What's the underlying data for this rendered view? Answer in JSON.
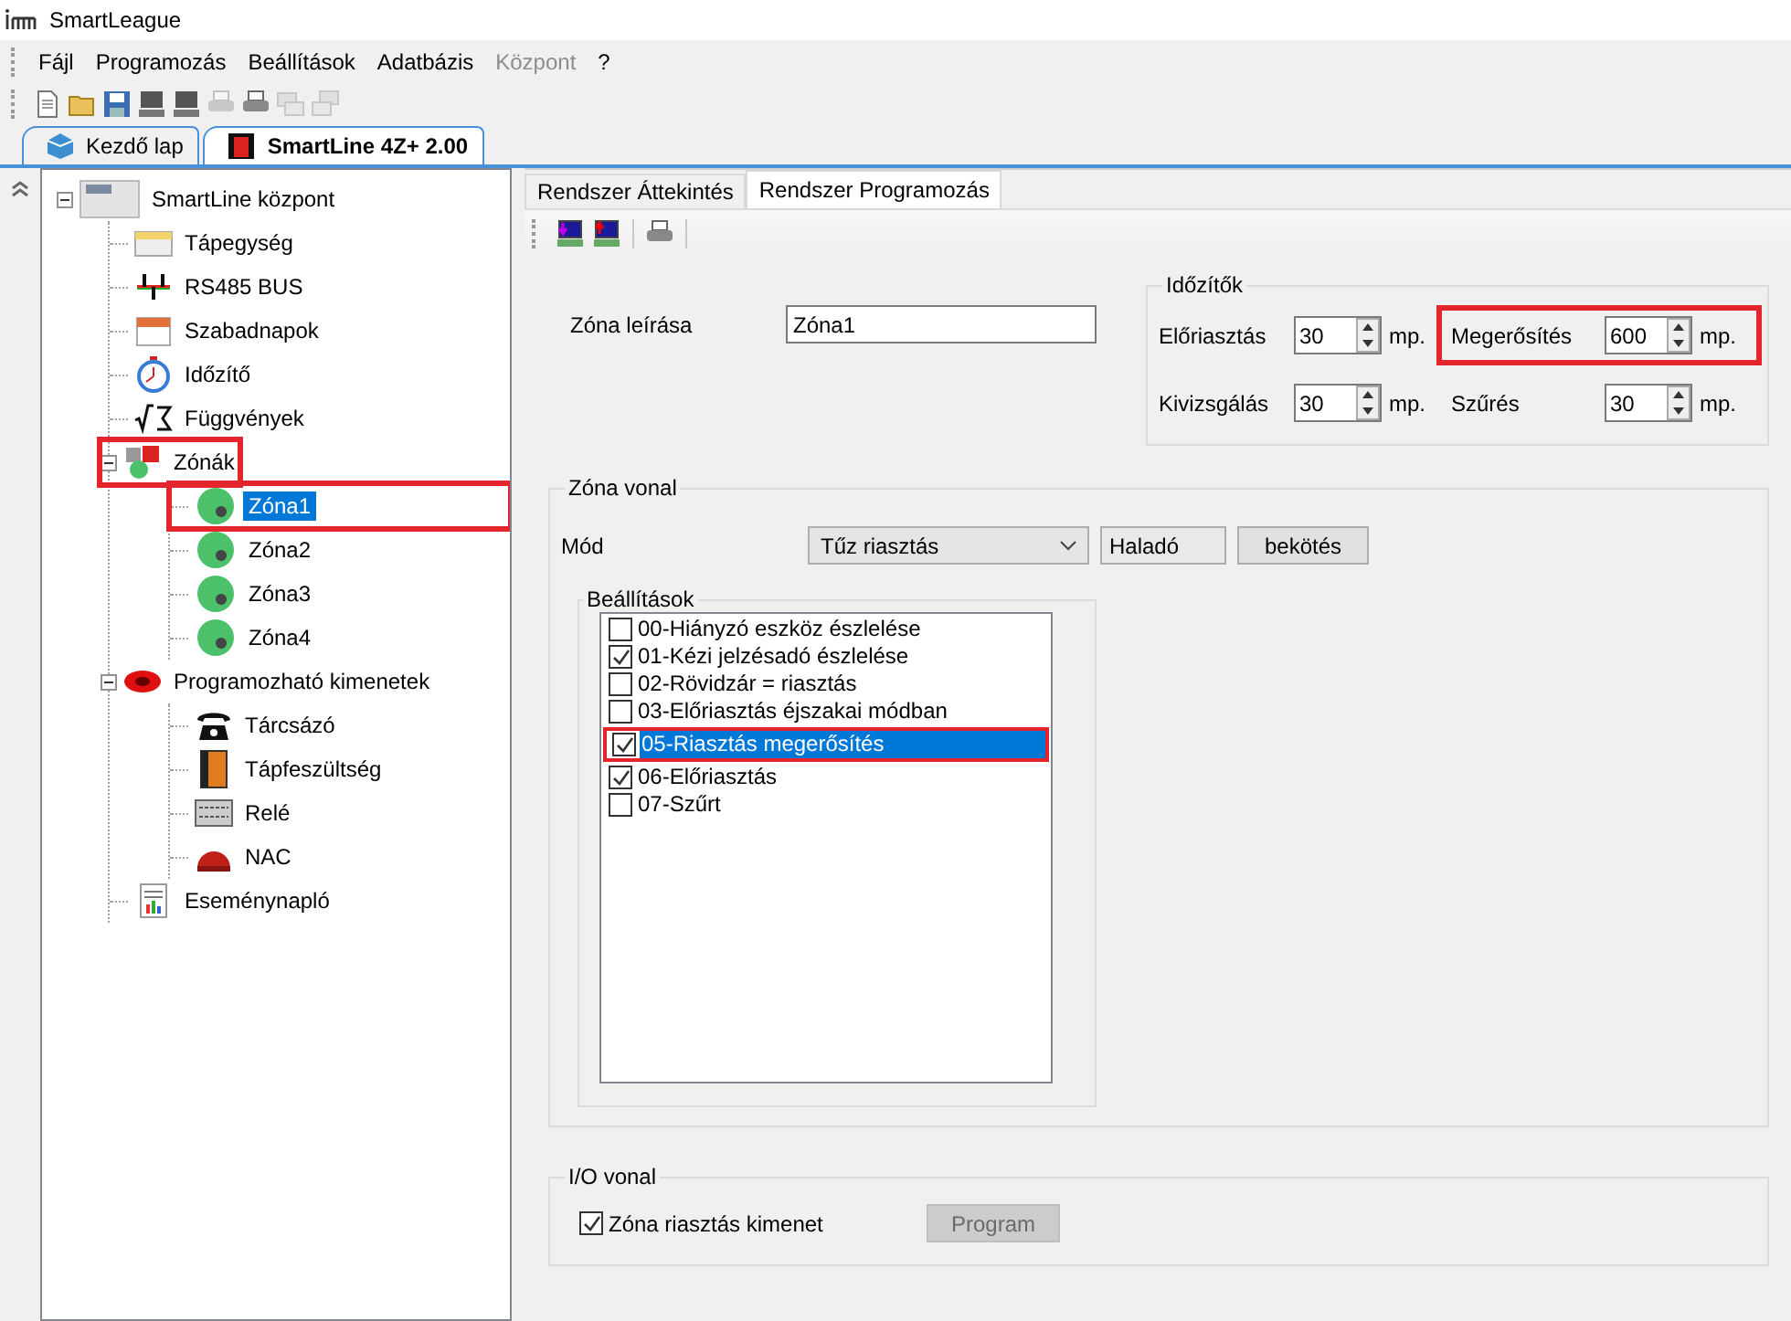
{
  "window": {
    "title": "SmartLeague"
  },
  "menu": [
    {
      "label": "Fájl",
      "disabled": false
    },
    {
      "label": "Programozás",
      "disabled": false
    },
    {
      "label": "Beállítások",
      "disabled": false
    },
    {
      "label": "Adatbázis",
      "disabled": false
    },
    {
      "label": "Központ",
      "disabled": true
    },
    {
      "label": "?",
      "disabled": false
    }
  ],
  "document_tabs": [
    {
      "label": "Kezdő lap",
      "selected": false
    },
    {
      "label": "SmartLine 4Z+ 2.00",
      "selected": true
    }
  ],
  "tree": {
    "label": "SmartLine központ",
    "expanded": true,
    "selected": false,
    "highlighted": false,
    "children": [
      {
        "label": "Tápegység",
        "selected": false,
        "highlighted": false
      },
      {
        "label": "RS485 BUS",
        "selected": false,
        "highlighted": false
      },
      {
        "label": "Szabadnapok",
        "selected": false,
        "highlighted": false
      },
      {
        "label": "Időzítő",
        "selected": false,
        "highlighted": false
      },
      {
        "label": "Függvények",
        "selected": false,
        "highlighted": false
      },
      {
        "label": "Zónák",
        "expanded": true,
        "selected": false,
        "highlighted": true,
        "children": [
          {
            "label": "Zóna1",
            "selected": true,
            "highlighted": true
          },
          {
            "label": "Zóna2",
            "selected": false,
            "highlighted": false
          },
          {
            "label": "Zóna3",
            "selected": false,
            "highlighted": false
          },
          {
            "label": "Zóna4",
            "selected": false,
            "highlighted": false
          }
        ]
      },
      {
        "label": "Programozható kimenetek",
        "expanded": true,
        "selected": false,
        "highlighted": false,
        "children": [
          {
            "label": "Tárcsázó",
            "selected": false,
            "highlighted": false
          },
          {
            "label": "Tápfeszültség",
            "selected": false,
            "highlighted": false
          },
          {
            "label": "Relé",
            "selected": false,
            "highlighted": false
          },
          {
            "label": "NAC",
            "selected": false,
            "highlighted": false
          }
        ]
      },
      {
        "label": "Eseménynapló",
        "selected": false,
        "highlighted": false
      }
    ]
  },
  "page_tabs": [
    {
      "label": "Rendszer Áttekintés",
      "selected": false
    },
    {
      "label": "Rendszer Programozás",
      "selected": true
    }
  ],
  "description": {
    "label": "Zóna leírása",
    "value": "Zóna1"
  },
  "timers": {
    "title": "Időzítők",
    "items": [
      {
        "label": "Előriasztás",
        "value": "30",
        "unit": "mp.",
        "highlighted": false
      },
      {
        "label": "Megerősítés",
        "value": "600",
        "unit": "mp.",
        "highlighted": true
      },
      {
        "label": "Kivizsgálás",
        "value": "30",
        "unit": "mp.",
        "highlighted": false
      },
      {
        "label": "Szűrés",
        "value": "30",
        "unit": "mp.",
        "highlighted": false
      }
    ]
  },
  "zone_line": {
    "title": "Zóna vonal",
    "mode_label": "Mód",
    "mode_value": "Tűz riasztás",
    "advanced": "Haladó",
    "wiring_button": "bekötés",
    "settings": {
      "title": "Beállítások",
      "items": [
        {
          "label": "00-Hiányzó eszköz észlelése",
          "checked": false,
          "selected": false,
          "highlighted": false
        },
        {
          "label": "01-Kézi jelzésadó észlelése",
          "checked": true,
          "selected": false,
          "highlighted": false
        },
        {
          "label": "02-Rövidzár = riasztás",
          "checked": false,
          "selected": false,
          "highlighted": false
        },
        {
          "label": "03-Előriasztás éjszakai módban",
          "checked": false,
          "selected": false,
          "highlighted": false
        },
        {
          "label": "05-Riasztás megerősítés",
          "checked": true,
          "selected": true,
          "highlighted": true
        },
        {
          "label": "06-Előriasztás",
          "checked": true,
          "selected": false,
          "highlighted": false
        },
        {
          "label": "07-Szűrt",
          "checked": false,
          "selected": false,
          "highlighted": false
        }
      ]
    }
  },
  "io_line": {
    "title": "I/O vonal",
    "checkbox_label": "Zóna riasztás kimenet",
    "checked": true,
    "button_label": "Program",
    "button_disabled": true
  }
}
